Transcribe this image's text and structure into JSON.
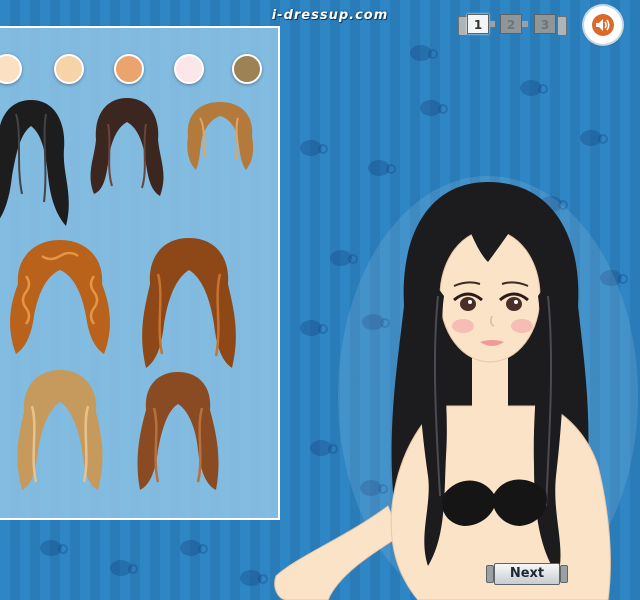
{
  "header": {
    "site_title": "i-dressup.com"
  },
  "pages": {
    "items": [
      {
        "label": "1",
        "active": true
      },
      {
        "label": "2",
        "active": false
      },
      {
        "label": "3",
        "active": false
      }
    ]
  },
  "sound": {
    "icon": "speaker-icon"
  },
  "swatches": {
    "colors": [
      "#fbe0c4",
      "#f7d3a8",
      "#eba46e",
      "#fde6ea",
      "#9c8254"
    ]
  },
  "hair_options": {
    "count": 8,
    "colors": [
      "#1d1d1d",
      "#3b2620",
      "#b37a3b",
      "#b8621c",
      "#8e4818",
      "#c69a5c",
      "#8a4a22"
    ]
  },
  "model": {
    "hair_color": "#1c1c1f",
    "skin_color": "#fbe3c8",
    "top_color": "#151515"
  },
  "navigation": {
    "next_label": "Next"
  },
  "theme": {
    "background": "#2f86c4",
    "panel": "#a0cdeb"
  }
}
